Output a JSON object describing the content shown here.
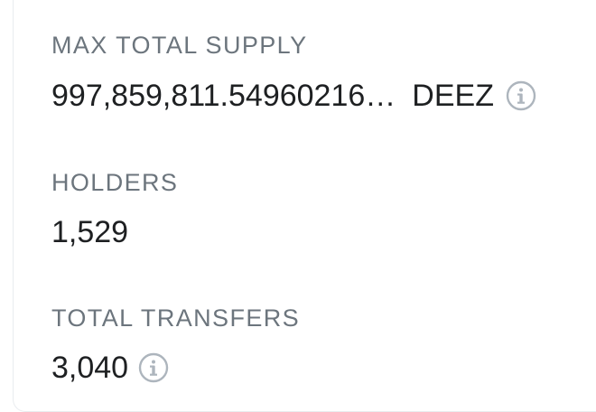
{
  "max_total_supply": {
    "label": "MAX TOTAL SUPPLY",
    "value": "997,859,811.54960216…",
    "unit": "DEEZ",
    "info_icon": "info-icon"
  },
  "holders": {
    "label": "HOLDERS",
    "value": "1,529"
  },
  "total_transfers": {
    "label": "TOTAL TRANSFERS",
    "value": "3,040",
    "info_icon": "info-icon"
  },
  "colors": {
    "label": "#6c757d",
    "value": "#1e2022",
    "icon": "#adb5bd"
  }
}
